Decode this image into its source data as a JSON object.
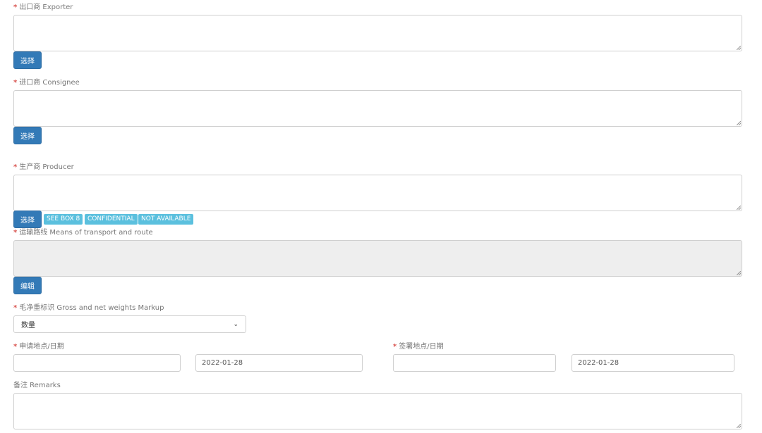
{
  "exporter": {
    "required": "*",
    "label": "出口商 Exporter",
    "value": "",
    "select_label": "选择"
  },
  "consignee": {
    "required": "*",
    "label": "进口商 Consignee",
    "value": "",
    "select_label": "选择"
  },
  "producer": {
    "required": "*",
    "label": "生产商 Producer",
    "value": "",
    "select_label": "选择",
    "tags": [
      "SEE BOX 8",
      "CONFIDENTIAL",
      "NOT AVAILABLE"
    ]
  },
  "transport": {
    "required": "*",
    "label": "运输路线 Means of transport and route",
    "value": "",
    "edit_label": "编辑"
  },
  "weights": {
    "required": "*",
    "label": "毛净重标识 Gross and net weights Markup",
    "selected": "数量"
  },
  "application": {
    "required": "*",
    "label": "申请地点/日期",
    "place": "",
    "date": "2022-01-28"
  },
  "signing": {
    "required": "*",
    "label": "签署地点/日期",
    "place": "",
    "date": "2022-01-28"
  },
  "remarks": {
    "label": "备注 Remarks",
    "value": ""
  }
}
